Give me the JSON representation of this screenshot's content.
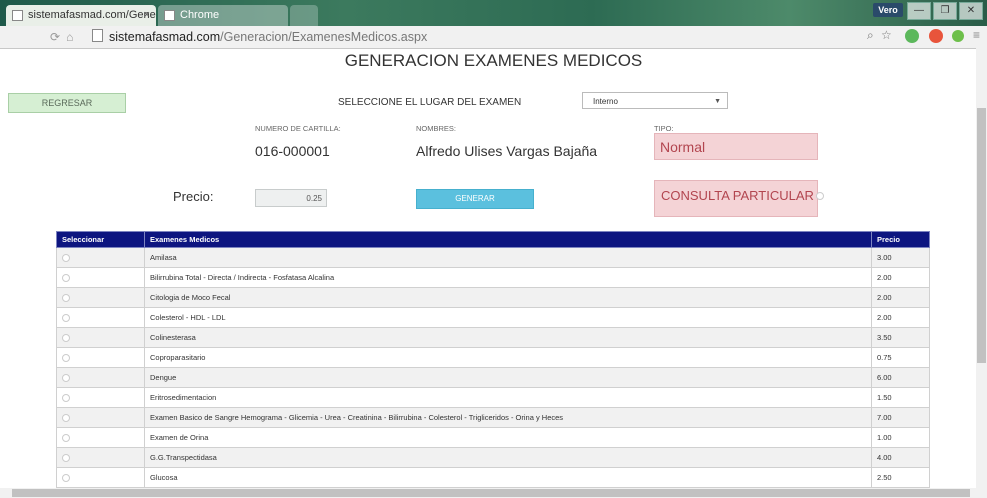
{
  "browser": {
    "tabs": [
      {
        "title": "sistemafasmad.com/Gene"
      },
      {
        "title": "Chrome"
      }
    ],
    "close_glyph": "×",
    "profile_name": "Vero",
    "url_host": "sistemafasmad.com",
    "url_path": "/Generacion/ExamenesMedicos.aspx"
  },
  "page": {
    "title": "GENERACION EXAMENES MEDICOS",
    "back_button": "REGRESAR",
    "lugar_label": "SELECCIONE EL LUGAR DEL EXAMEN",
    "lugar_value": "Interno",
    "cartilla_label": "NUMERO DE CARTILLA:",
    "cartilla_value": "016-000001",
    "nombres_label": "NOMBRES:",
    "nombres_value": "Alfredo Ulises Vargas Bajaña",
    "tipo_label": "TIPO:",
    "tipo_value": "Normal",
    "precio_label": "Precio:",
    "precio_value": "0.25",
    "generar_button": "GENERAR",
    "consulta_value": "CONSULTA PARTICULAR"
  },
  "table": {
    "headers": [
      "Seleccionar",
      "Examenes Medicos",
      "Precio"
    ],
    "rows": [
      {
        "name": "Amilasa",
        "price": "3.00"
      },
      {
        "name": "Bilirrubina Total - Directa / Indirecta - Fosfatasa Alcalina",
        "price": "2.00"
      },
      {
        "name": "Citologia de Moco Fecal",
        "price": "2.00"
      },
      {
        "name": "Colesterol - HDL - LDL",
        "price": "2.00"
      },
      {
        "name": "Colinesterasa",
        "price": "3.50"
      },
      {
        "name": "Coproparasitario",
        "price": "0.75"
      },
      {
        "name": "Dengue",
        "price": "6.00"
      },
      {
        "name": "Eritrosedimentacion",
        "price": "1.50"
      },
      {
        "name": "Examen Basico de Sangre Hemograma - Glicemia - Urea - Creatinina - Bilirrubina - Colesterol - Trigliceridos - Orina y Heces",
        "price": "7.00"
      },
      {
        "name": "Examen de Orina",
        "price": "1.00"
      },
      {
        "name": "G.G.Transpectidasa",
        "price": "4.00"
      },
      {
        "name": "Glucosa",
        "price": "2.50"
      }
    ]
  },
  "colors": {
    "table_header": "#0d1580",
    "generar": "#5bc0de",
    "tipo_box": "#f4d3d6",
    "back_button": "#d6efd3"
  }
}
